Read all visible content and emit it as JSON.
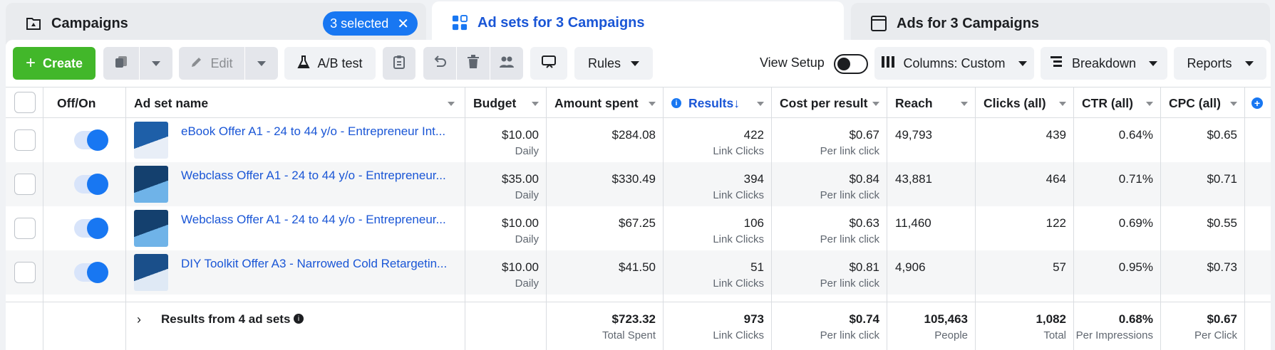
{
  "tabs": {
    "campaigns": {
      "label": "Campaigns",
      "selected_pill": "3 selected"
    },
    "adsets": {
      "label": "Ad sets for 3 Campaigns"
    },
    "ads": {
      "label": "Ads for 3 Campaigns"
    }
  },
  "toolbar": {
    "create_label": "Create",
    "edit_label": "Edit",
    "ab_test_label": "A/B test",
    "rules_label": "Rules",
    "view_setup_label": "View Setup",
    "columns_label": "Columns: Custom",
    "breakdown_label": "Breakdown",
    "reports_label": "Reports"
  },
  "columns": {
    "offon": "Off/On",
    "name": "Ad set name",
    "budget": "Budget",
    "amount": "Amount spent",
    "results": "Results",
    "results_arrow": "↓",
    "cpr": "Cost per result",
    "reach": "Reach",
    "clicks": "Clicks (all)",
    "ctr": "CTR (all)",
    "cpc": "CPC (all)"
  },
  "rows": [
    {
      "name": "eBook Offer A1 - 24 to 44 y/o - Entrepreneur Int...",
      "budget": "$10.00",
      "budget_sub": "Daily",
      "amount": "$284.08",
      "results": "422",
      "results_sub": "Link Clicks",
      "cpr": "$0.67",
      "cpr_sub": "Per link click",
      "reach": "49,793",
      "clicks": "439",
      "ctr": "0.64%",
      "cpc": "$0.65",
      "on": true
    },
    {
      "name": "Webclass Offer A1 - 24 to 44 y/o - Entrepreneur...",
      "budget": "$35.00",
      "budget_sub": "Daily",
      "amount": "$330.49",
      "results": "394",
      "results_sub": "Link Clicks",
      "cpr": "$0.84",
      "cpr_sub": "Per link click",
      "reach": "43,881",
      "clicks": "464",
      "ctr": "0.71%",
      "cpc": "$0.71",
      "on": true
    },
    {
      "name": "Webclass Offer A1 - 24 to 44 y/o - Entrepreneur...",
      "budget": "$10.00",
      "budget_sub": "Daily",
      "amount": "$67.25",
      "results": "106",
      "results_sub": "Link Clicks",
      "cpr": "$0.63",
      "cpr_sub": "Per link click",
      "reach": "11,460",
      "clicks": "122",
      "ctr": "0.69%",
      "cpc": "$0.55",
      "on": true
    },
    {
      "name": "DIY Toolkit Offer A3 - Narrowed Cold Retargetin...",
      "budget": "$10.00",
      "budget_sub": "Daily",
      "amount": "$41.50",
      "results": "51",
      "results_sub": "Link Clicks",
      "cpr": "$0.81",
      "cpr_sub": "Per link click",
      "reach": "4,906",
      "clicks": "57",
      "ctr": "0.95%",
      "cpc": "$0.73",
      "on": true
    }
  ],
  "totals": {
    "label": "Results from 4 ad sets",
    "amount": "$723.32",
    "amount_sub": "Total Spent",
    "results": "973",
    "results_sub": "Link Clicks",
    "cpr": "$0.74",
    "cpr_sub": "Per link click",
    "reach": "105,463",
    "reach_sub": "People",
    "clicks": "1,082",
    "clicks_sub": "Total",
    "ctr": "0.68%",
    "ctr_sub": "Per Impressions",
    "cpc": "$0.67",
    "cpc_sub": "Per Click"
  },
  "colors": {
    "accent": "#1877f2",
    "create": "#42b72a",
    "link": "#1a56d6"
  }
}
